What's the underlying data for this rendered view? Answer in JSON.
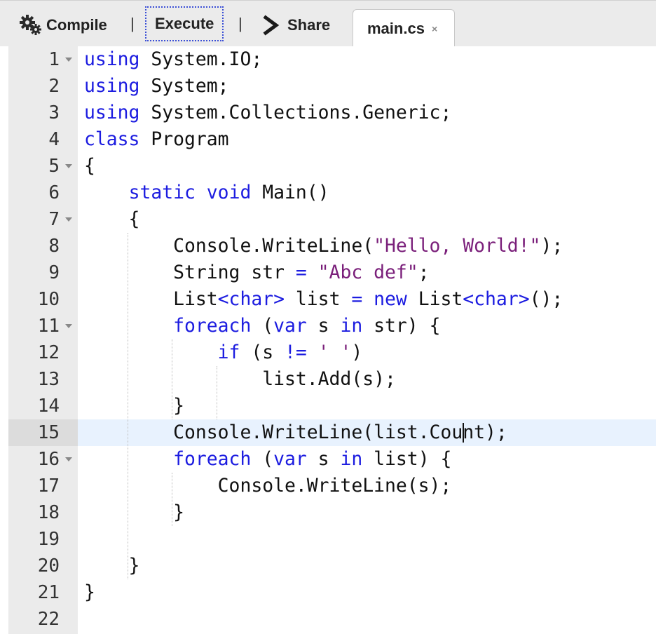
{
  "toolbar": {
    "compile_label": "Compile",
    "execute_label": "Execute",
    "share_label": "Share",
    "separator": "|"
  },
  "tab": {
    "filename": "main.cs",
    "close_glyph": "×"
  },
  "icons": {
    "compile": "gear-icon",
    "share": "chevron-right-icon",
    "fold": "fold-arrow-icon"
  },
  "colors": {
    "keyword": "#1c1ce0",
    "string": "#7a1f7a",
    "active_line": "#e8f2fe",
    "execute_focus_border": "#3b4fd6"
  },
  "editor": {
    "active_line": 15,
    "lines": [
      {
        "n": "1",
        "fold": true,
        "tokens": [
          {
            "t": "k",
            "v": "using"
          },
          {
            "t": "p",
            "v": " System.IO;"
          }
        ]
      },
      {
        "n": "2",
        "tokens": [
          {
            "t": "k",
            "v": "using"
          },
          {
            "t": "p",
            "v": " System;"
          }
        ]
      },
      {
        "n": "3",
        "tokens": [
          {
            "t": "k",
            "v": "using"
          },
          {
            "t": "p",
            "v": " System.Collections.Generic;"
          }
        ]
      },
      {
        "n": "4",
        "tokens": [
          {
            "t": "k",
            "v": "class"
          },
          {
            "t": "p",
            "v": " Program"
          }
        ]
      },
      {
        "n": "5",
        "fold": true,
        "tokens": [
          {
            "t": "p",
            "v": "{"
          }
        ]
      },
      {
        "n": "6",
        "tokens": [
          {
            "t": "p",
            "v": "    "
          },
          {
            "t": "k",
            "v": "static"
          },
          {
            "t": "p",
            "v": " "
          },
          {
            "t": "k",
            "v": "void"
          },
          {
            "t": "p",
            "v": " Main()"
          }
        ]
      },
      {
        "n": "7",
        "fold": true,
        "tokens": [
          {
            "t": "p",
            "v": "    {"
          }
        ]
      },
      {
        "n": "8",
        "tokens": [
          {
            "t": "p",
            "v": "        Console.WriteLine("
          },
          {
            "t": "s",
            "v": "\"Hello, World!\""
          },
          {
            "t": "p",
            "v": ");"
          }
        ]
      },
      {
        "n": "9",
        "tokens": [
          {
            "t": "p",
            "v": "        String str "
          },
          {
            "t": "k",
            "v": "="
          },
          {
            "t": "p",
            "v": " "
          },
          {
            "t": "s",
            "v": "\"Abc def\""
          },
          {
            "t": "p",
            "v": ";"
          }
        ]
      },
      {
        "n": "10",
        "tokens": [
          {
            "t": "p",
            "v": "        List"
          },
          {
            "t": "k",
            "v": "<char>"
          },
          {
            "t": "p",
            "v": " list "
          },
          {
            "t": "k",
            "v": "="
          },
          {
            "t": "p",
            "v": " "
          },
          {
            "t": "k",
            "v": "new"
          },
          {
            "t": "p",
            "v": " List"
          },
          {
            "t": "k",
            "v": "<char>"
          },
          {
            "t": "p",
            "v": "();"
          }
        ]
      },
      {
        "n": "11",
        "fold": true,
        "tokens": [
          {
            "t": "p",
            "v": "        "
          },
          {
            "t": "k",
            "v": "foreach"
          },
          {
            "t": "p",
            "v": " ("
          },
          {
            "t": "k",
            "v": "var"
          },
          {
            "t": "p",
            "v": " s "
          },
          {
            "t": "k",
            "v": "in"
          },
          {
            "t": "p",
            "v": " str) {"
          }
        ]
      },
      {
        "n": "12",
        "tokens": [
          {
            "t": "p",
            "v": "            "
          },
          {
            "t": "k",
            "v": "if"
          },
          {
            "t": "p",
            "v": " (s "
          },
          {
            "t": "k",
            "v": "!="
          },
          {
            "t": "p",
            "v": " "
          },
          {
            "t": "s",
            "v": "' '"
          },
          {
            "t": "p",
            "v": ")"
          }
        ]
      },
      {
        "n": "13",
        "tokens": [
          {
            "t": "p",
            "v": "                list.Add(s);"
          }
        ]
      },
      {
        "n": "14",
        "tokens": [
          {
            "t": "p",
            "v": "        }"
          }
        ]
      },
      {
        "n": "15",
        "tokens": [
          {
            "t": "p",
            "v": "        Console.WriteLine(list.Count);"
          }
        ]
      },
      {
        "n": "16",
        "fold": true,
        "tokens": [
          {
            "t": "p",
            "v": "        "
          },
          {
            "t": "k",
            "v": "foreach"
          },
          {
            "t": "p",
            "v": " ("
          },
          {
            "t": "k",
            "v": "var"
          },
          {
            "t": "p",
            "v": " s "
          },
          {
            "t": "k",
            "v": "in"
          },
          {
            "t": "p",
            "v": " list) {"
          }
        ]
      },
      {
        "n": "17",
        "tokens": [
          {
            "t": "p",
            "v": "            Console.WriteLine(s);"
          }
        ]
      },
      {
        "n": "18",
        "tokens": [
          {
            "t": "p",
            "v": "        }"
          }
        ]
      },
      {
        "n": "19",
        "tokens": []
      },
      {
        "n": "20",
        "tokens": [
          {
            "t": "p",
            "v": "    }"
          }
        ]
      },
      {
        "n": "21",
        "tokens": [
          {
            "t": "p",
            "v": "}"
          }
        ]
      },
      {
        "n": "22",
        "tokens": []
      }
    ]
  }
}
